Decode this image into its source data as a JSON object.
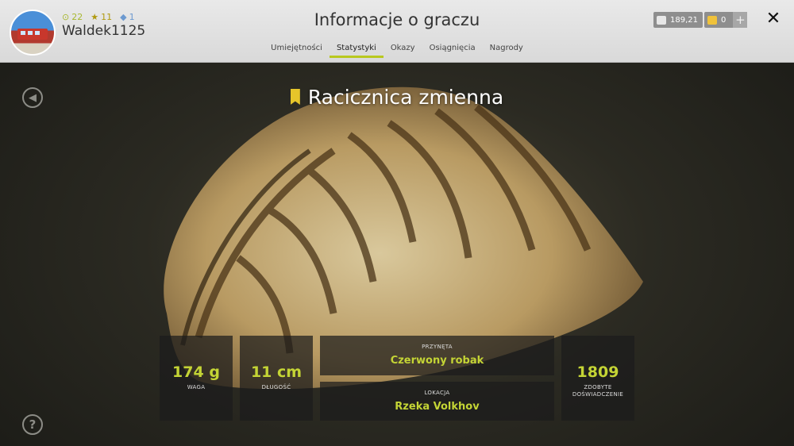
{
  "header": {
    "title": "Informacje o graczu",
    "player": {
      "name": "Waldek1125",
      "level": "22",
      "stars": "11",
      "gems": "1"
    },
    "tabs": [
      {
        "label": "Umiejętności",
        "active": false
      },
      {
        "label": "Statystyki",
        "active": true
      },
      {
        "label": "Okazy",
        "active": false
      },
      {
        "label": "Osiągnięcia",
        "active": false
      },
      {
        "label": "Nagrody",
        "active": false
      }
    ],
    "currency": {
      "silver": "189,21",
      "gold": "0"
    }
  },
  "trophy": {
    "name": "Racicznica zmienna",
    "weight": {
      "value": "174 g",
      "label": "WAGA"
    },
    "length": {
      "value": "11 cm",
      "label": "DŁUGOŚĆ"
    },
    "bait": {
      "label": "PRZYNĘTA",
      "value": "Czerwony robak"
    },
    "location": {
      "label": "LOKACJA",
      "value": "Rzeka Volkhov"
    },
    "experience": {
      "value": "1809",
      "label": "ZDOBYTE DOŚWIADCZENIE"
    }
  },
  "colors": {
    "accent": "#c4d435",
    "bookmark": "#e6c52a",
    "topbar": "#e2e2e2"
  }
}
